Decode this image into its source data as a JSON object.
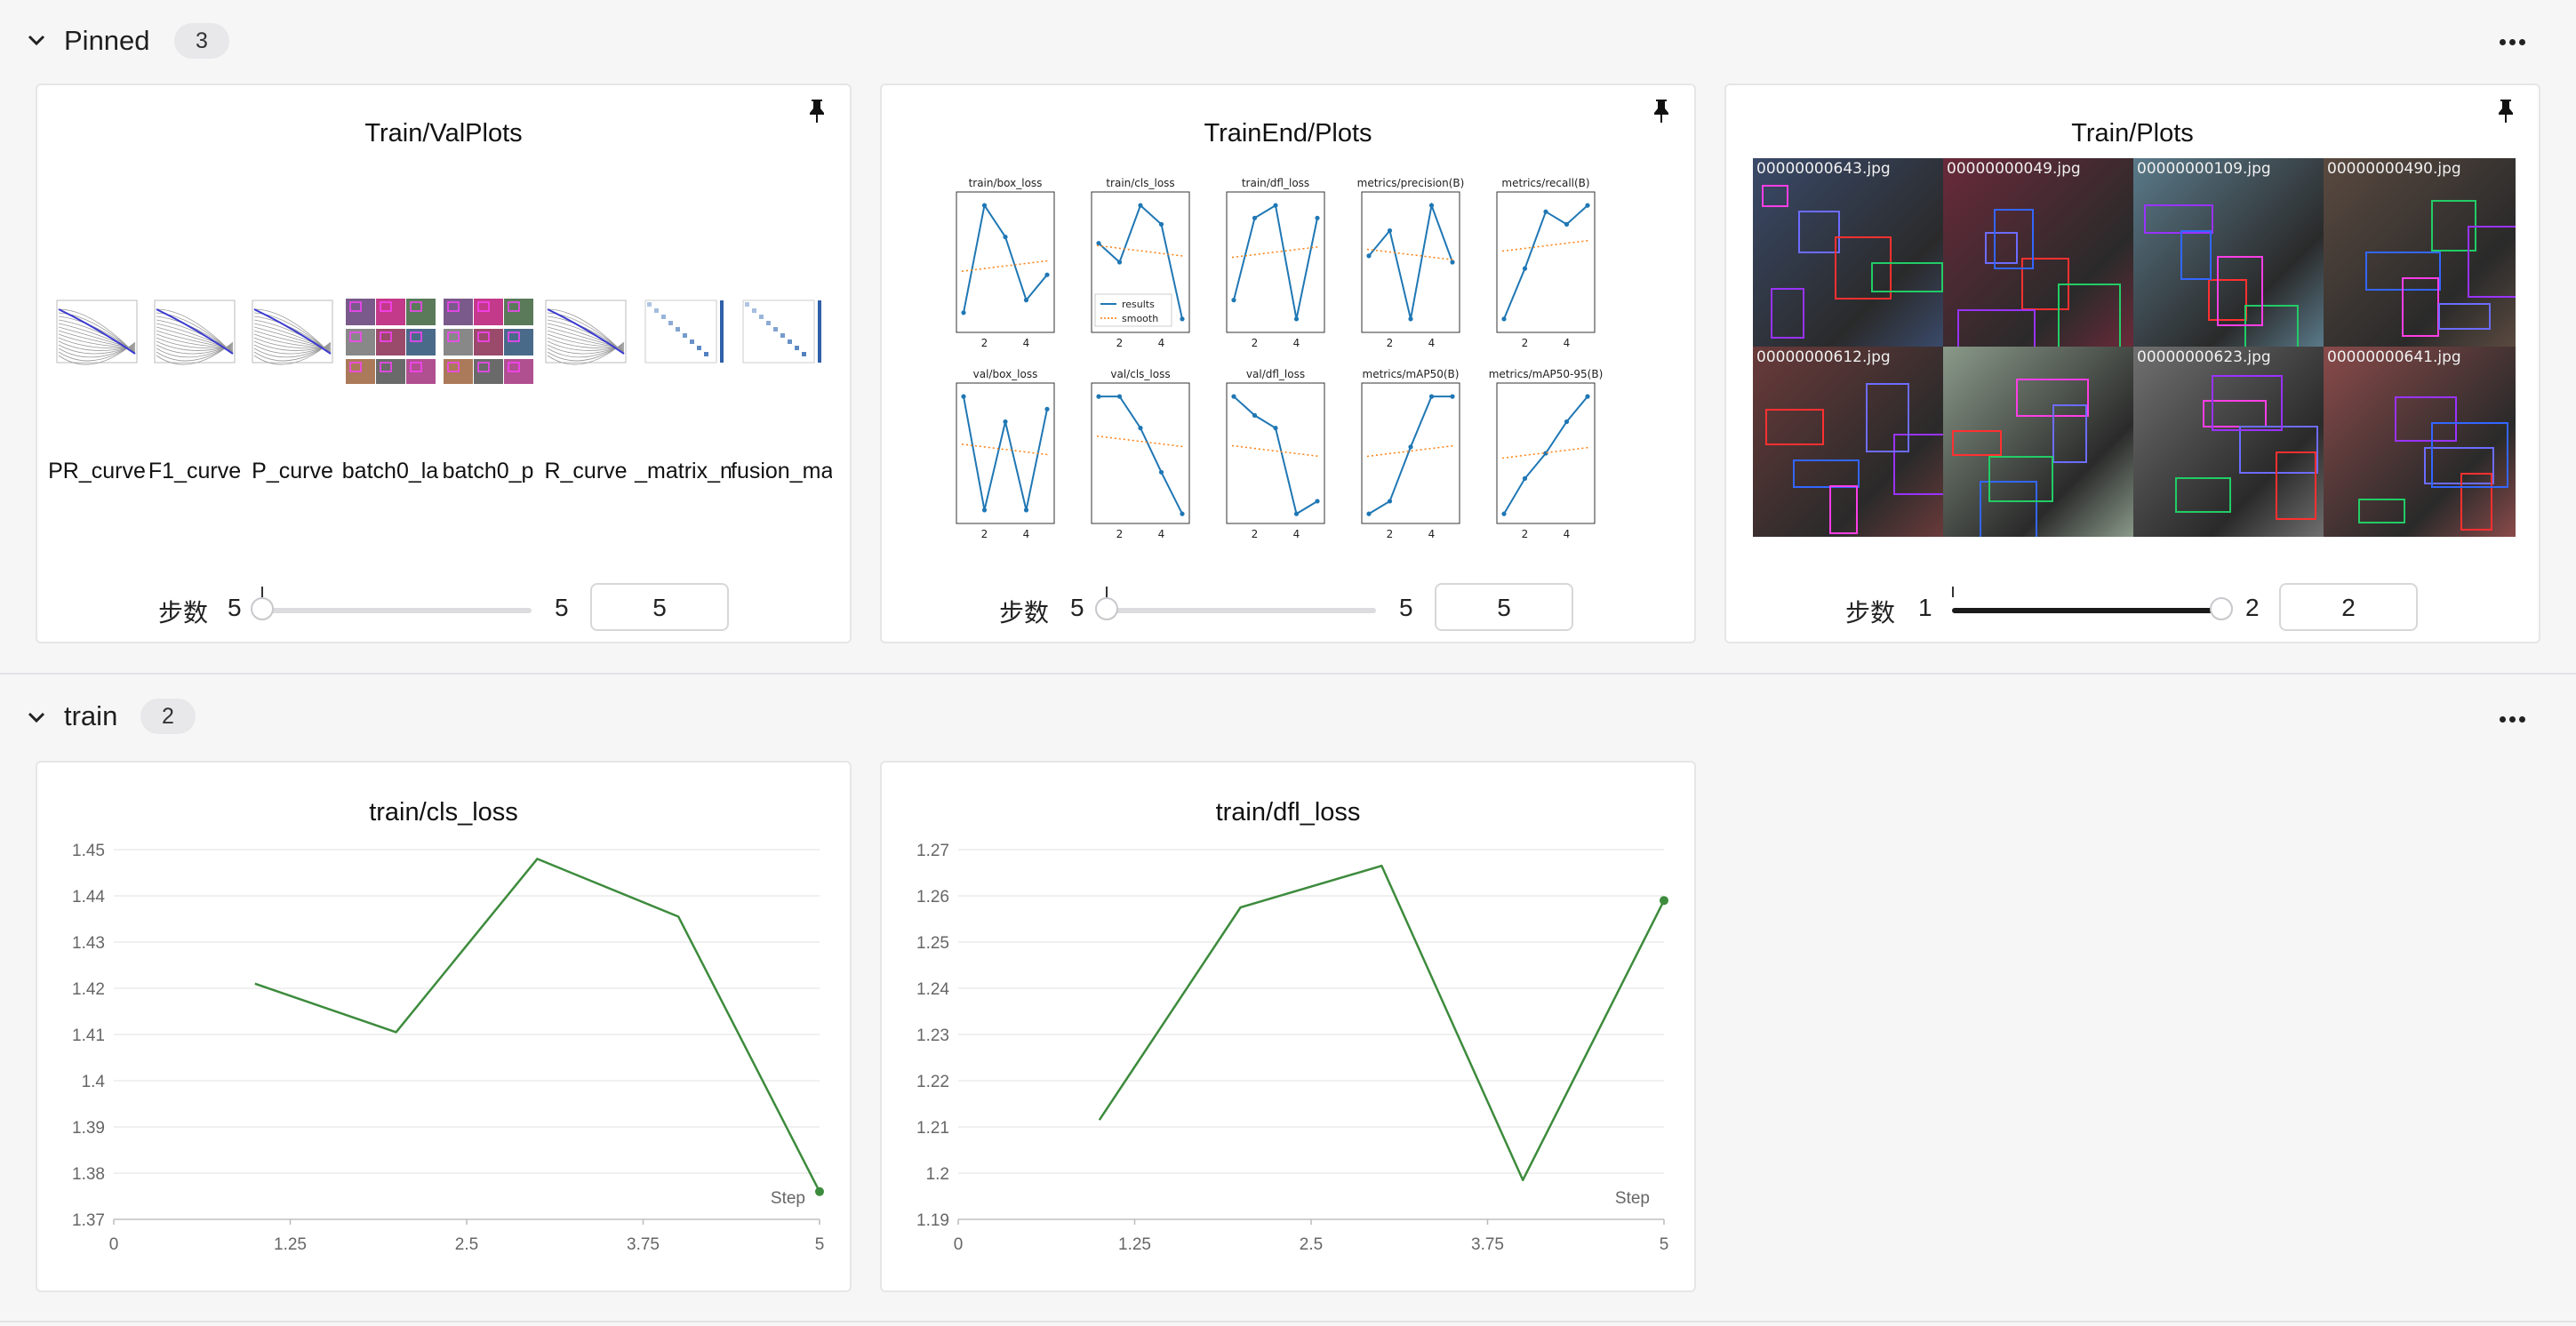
{
  "sections": {
    "pinned": {
      "title": "Pinned",
      "count": "3"
    },
    "train": {
      "title": "train",
      "count": "2"
    }
  },
  "icons": {
    "collapse": "chevron-down-icon",
    "more": "more-horizontal-icon",
    "pin": "pin-icon"
  },
  "colors": {
    "line": "#3d8b3d",
    "plot_blue": "#1f77b4",
    "plot_orange": "#ff7f0e"
  },
  "cards": {
    "trainval": {
      "title": "Train/ValPlots",
      "thumbs": [
        "PR_curve",
        "F1_curve",
        "P_curve",
        "batch0_la",
        "batch0_p",
        "R_curve",
        "_matrix_n",
        "fusion_ma"
      ],
      "step": {
        "label": "步数",
        "min": "5",
        "max": "5",
        "value": "5"
      }
    },
    "trainend": {
      "title": "TrainEnd/Plots",
      "subplots": [
        "train/box_loss",
        "train/cls_loss",
        "train/dfl_loss",
        "metrics/precision(B)",
        "metrics/recall(B)",
        "val/box_loss",
        "val/cls_loss",
        "val/dfl_loss",
        "metrics/mAP50(B)",
        "metrics/mAP50-95(B)"
      ],
      "legend": [
        "results",
        "smooth"
      ],
      "step": {
        "label": "步数",
        "min": "5",
        "max": "5",
        "value": "5"
      }
    },
    "trainplots": {
      "title": "Train/Plots",
      "tile_labels": [
        "00000000643.jpg",
        "00000000049.jpg",
        "00000000109.jpg",
        "00000000490.jpg",
        "00000000612.jpg",
        "",
        "00000000623.jpg",
        "00000000641.jpg"
      ],
      "step": {
        "label": "步数",
        "min": "1",
        "max": "2",
        "value": "2"
      }
    },
    "cls_loss": {
      "title": "train/cls_loss",
      "x_ticks": [
        "0",
        "1.25",
        "2.5",
        "3.75",
        "5"
      ],
      "y_ticks": [
        "1.45",
        "1.44",
        "1.43",
        "1.42",
        "1.41",
        "1.4",
        "1.39",
        "1.38",
        "1.37"
      ],
      "x_label": "Step"
    },
    "dfl_loss": {
      "title": "train/dfl_loss",
      "x_ticks": [
        "0",
        "1.25",
        "2.5",
        "3.75",
        "5"
      ],
      "y_ticks": [
        "1.27",
        "1.26",
        "1.25",
        "1.24",
        "1.23",
        "1.22",
        "1.21",
        "1.2",
        "1.19"
      ],
      "x_label": "Step"
    }
  },
  "chart_data": [
    {
      "type": "line",
      "title": "train/cls_loss",
      "xlabel": "Step",
      "xlim": [
        0,
        5
      ],
      "ylim": [
        1.37,
        1.45
      ],
      "x": [
        1,
        2,
        3,
        4,
        5
      ],
      "series": [
        {
          "values": [
            1.421,
            1.4105,
            1.448,
            1.4355,
            1.376
          ]
        }
      ]
    },
    {
      "type": "line",
      "title": "train/dfl_loss",
      "xlabel": "Step",
      "xlim": [
        0,
        5
      ],
      "ylim": [
        1.19,
        1.27
      ],
      "x": [
        1,
        2,
        3,
        4,
        5
      ],
      "series": [
        {
          "values": [
            1.2115,
            1.2575,
            1.2665,
            1.1985,
            1.259
          ]
        }
      ]
    }
  ]
}
